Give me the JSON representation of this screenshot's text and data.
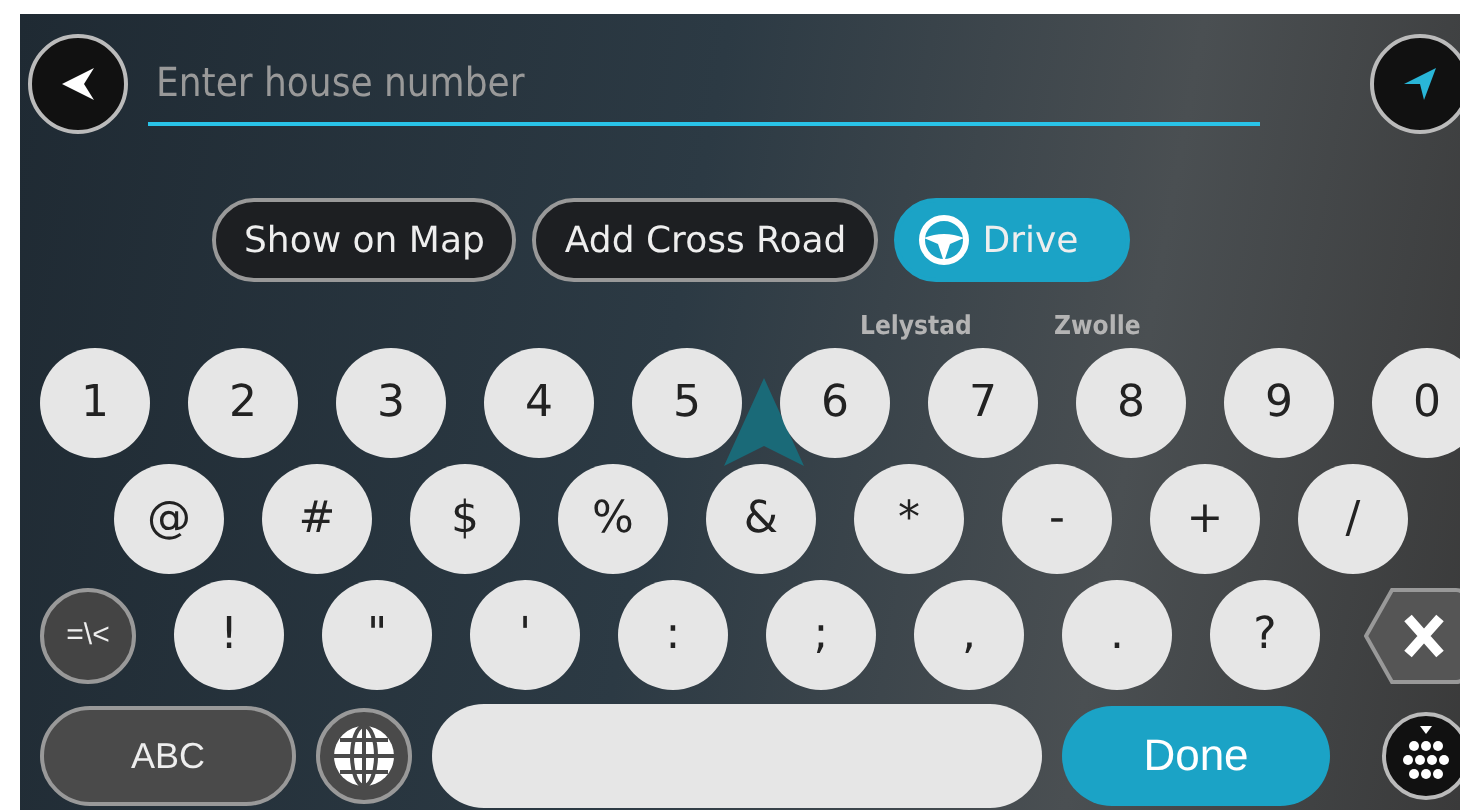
{
  "search": {
    "placeholder": "Enter house number"
  },
  "map_labels": [
    "Lelystad",
    "Zwolle"
  ],
  "actions": [
    {
      "label": "Show on Map",
      "kind": "outline"
    },
    {
      "label": "Add Cross Road",
      "kind": "outline"
    },
    {
      "label": "Drive",
      "kind": "primary"
    }
  ],
  "keyboard": {
    "rows": [
      [
        "1",
        "2",
        "3",
        "4",
        "5",
        "6",
        "7",
        "8",
        "9",
        "0"
      ],
      [
        "@",
        "#",
        "$",
        "%",
        "&",
        "*",
        "-",
        "+",
        "/"
      ],
      [
        "!",
        "\"",
        "'",
        ":",
        ";",
        ",",
        ".",
        "?"
      ]
    ],
    "mode_key": "=\\<",
    "abc_key": "ABC",
    "done_key": "Done"
  }
}
